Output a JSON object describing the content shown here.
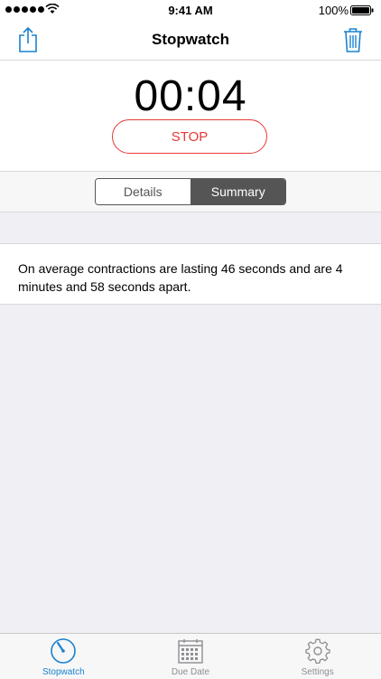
{
  "status_bar": {
    "time": "9:41 AM",
    "battery": "100%"
  },
  "nav": {
    "title": "Stopwatch"
  },
  "timer": {
    "display": "00:04",
    "stop_label": "STOP"
  },
  "segments": {
    "details_label": "Details",
    "summary_label": "Summary",
    "selected": "Summary"
  },
  "summary": {
    "text": "On average contractions are lasting 46 seconds and are 4 minutes and 58 seconds apart."
  },
  "tabs": [
    {
      "label": "Stopwatch",
      "icon": "stopwatch-icon",
      "active": true
    },
    {
      "label": "Due Date",
      "icon": "calendar-icon",
      "active": false
    },
    {
      "label": "Settings",
      "icon": "gear-icon",
      "active": false
    }
  ],
  "colors": {
    "accent": "#1a82d0",
    "stop": "#e53935",
    "segment_active": "#555555",
    "background": "#efeff4"
  }
}
